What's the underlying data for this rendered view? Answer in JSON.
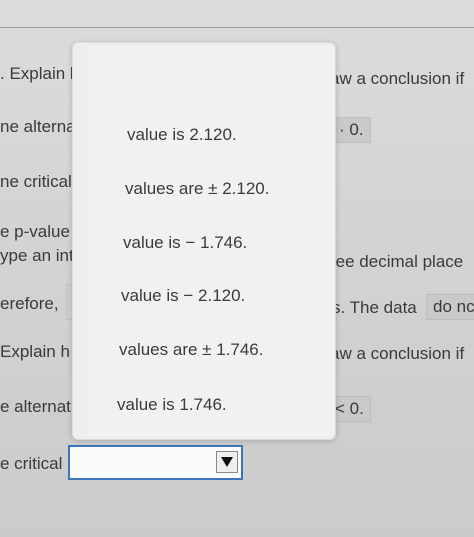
{
  "background_rows": [
    {
      "left": ". Explain h",
      "right": "aw a conclusion if"
    },
    {
      "left": "ne alternat",
      "right": "· 0."
    },
    {
      "left": "ne critical"
    },
    {
      "left": "e p-value"
    },
    {
      "left": "ype an int",
      "right": "ree decimal place"
    },
    {
      "left": "erefore,",
      "right_text": "s. The data",
      "right_chip": "do nc"
    },
    {
      "left": "Explain h",
      "right": "aw a conclusion if"
    },
    {
      "left": "e alternat",
      "right": "< 0."
    },
    {
      "left": "e critical"
    }
  ],
  "dropdown": {
    "options": [
      "value is 2.120.",
      "values are ± 2.120.",
      "value is − 1.746.",
      "value is − 2.120.",
      "values are ± 1.746.",
      "value is 1.746."
    ]
  },
  "select": {
    "value": "",
    "arrow_icon": "triangle-down-icon"
  }
}
